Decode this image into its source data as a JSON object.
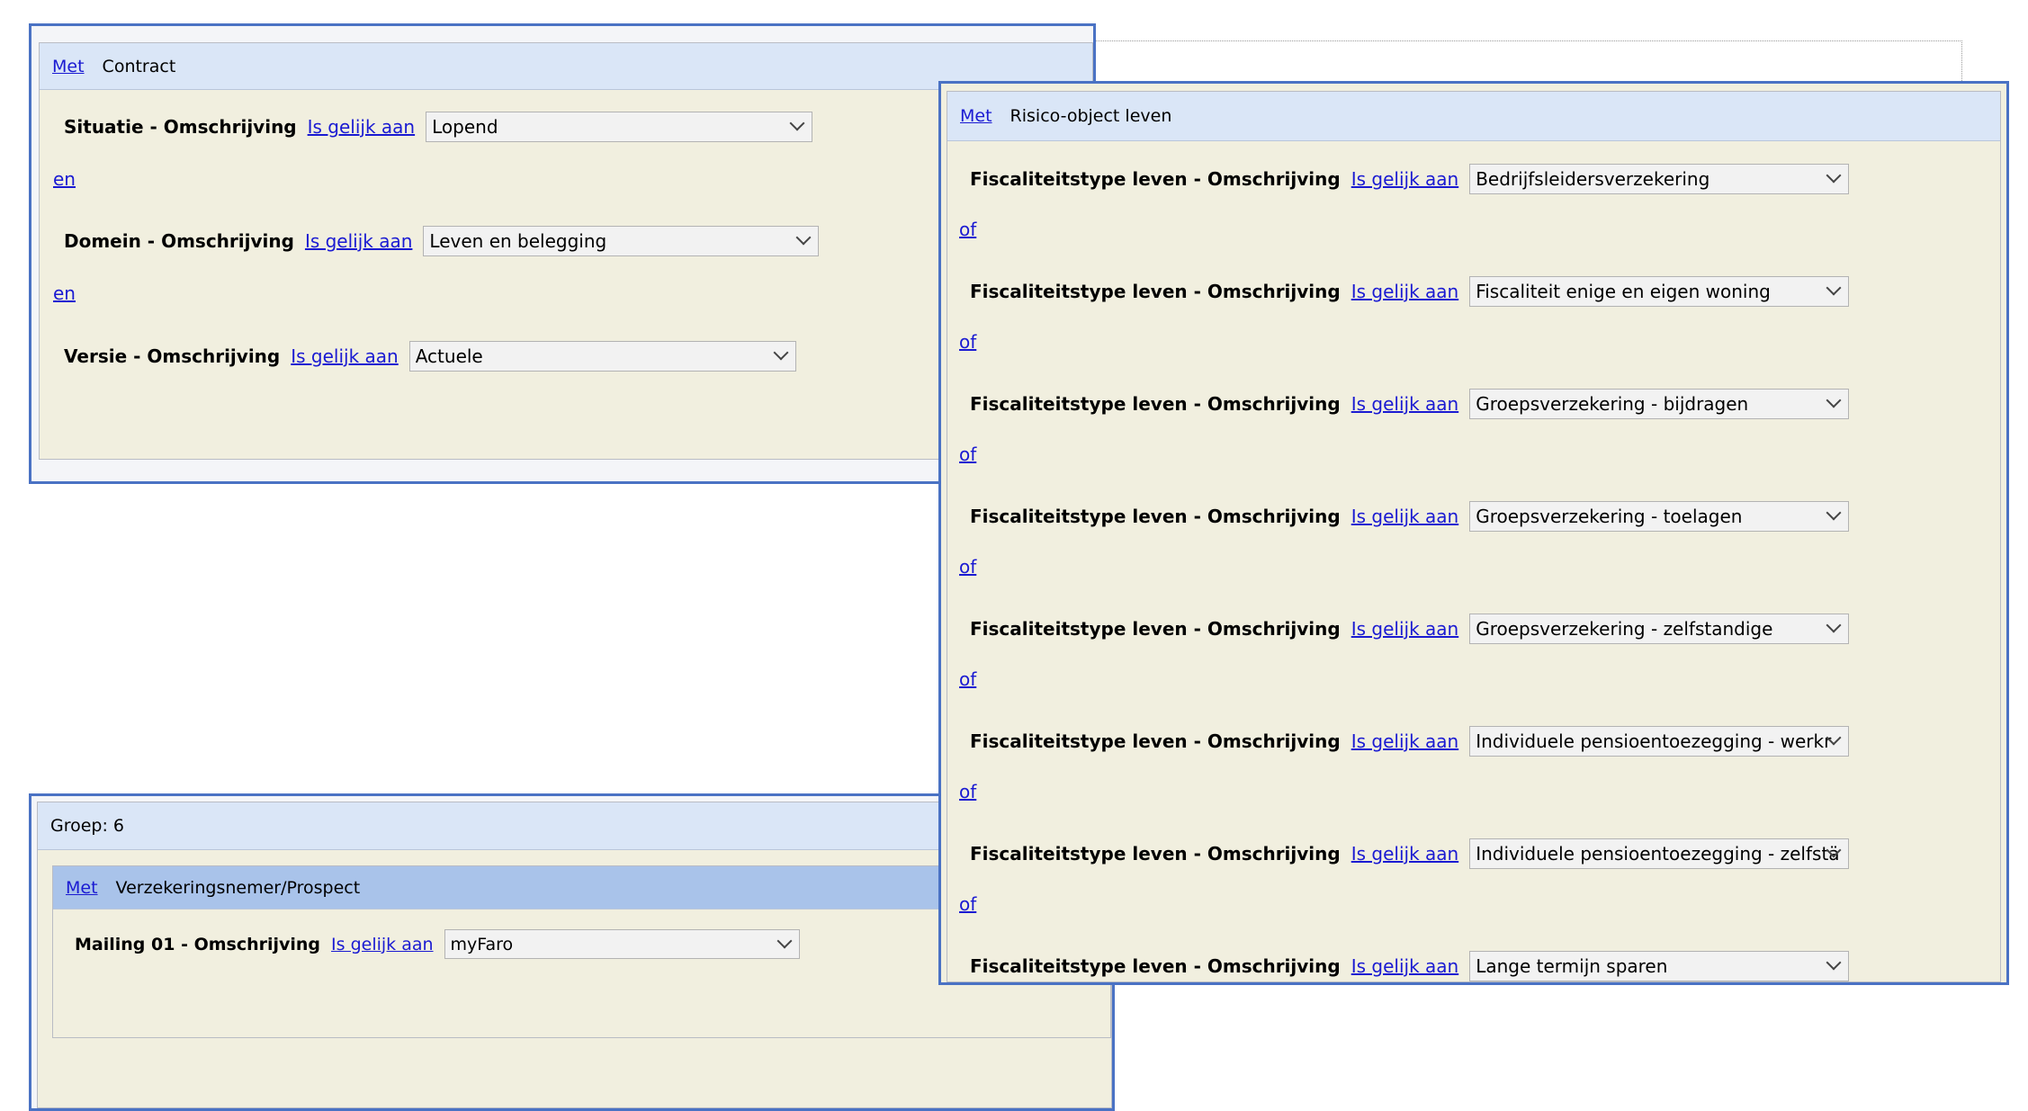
{
  "contract": {
    "met": "Met",
    "title": "Contract",
    "rows": [
      {
        "label": "Situatie - Omschrijving",
        "op": "Is gelijk aan",
        "value": "Lopend"
      },
      {
        "label": "Domein - Omschrijving",
        "op": "Is gelijk aan",
        "value": "Leven en belegging"
      },
      {
        "label": "Versie - Omschrijving",
        "op": "Is gelijk aan",
        "value": "Actuele"
      }
    ],
    "conj": [
      "en",
      "en"
    ]
  },
  "groep": {
    "title": "Groep: 6",
    "met": "Met",
    "sub_title": "Verzekeringsnemer/Prospect",
    "row": {
      "label": "Mailing 01 - Omschrijving",
      "op": "Is gelijk aan",
      "value": "myFaro"
    }
  },
  "risico": {
    "met": "Met",
    "title": "Risico-object leven",
    "rows": [
      {
        "label": "Fiscaliteitstype leven  - Omschrijving",
        "op": "Is gelijk aan",
        "value": "Bedrijfsleidersverzekering"
      },
      {
        "label": "Fiscaliteitstype leven  - Omschrijving",
        "op": "Is gelijk aan",
        "value": "Fiscaliteit enige en eigen woning"
      },
      {
        "label": "Fiscaliteitstype leven  - Omschrijving",
        "op": "Is gelijk aan",
        "value": "Groepsverzekering - bijdragen"
      },
      {
        "label": "Fiscaliteitstype leven  - Omschrijving",
        "op": "Is gelijk aan",
        "value": "Groepsverzekering - toelagen"
      },
      {
        "label": "Fiscaliteitstype leven  - Omschrijving",
        "op": "Is gelijk aan",
        "value": "Groepsverzekering - zelfstandige"
      },
      {
        "label": "Fiscaliteitstype leven  - Omschrijving",
        "op": "Is gelijk aan",
        "value": "Individuele pensioentoezegging - werkr"
      },
      {
        "label": "Fiscaliteitstype leven  - Omschrijving",
        "op": "Is gelijk aan",
        "value": "Individuele pensioentoezegging - zelfstä"
      },
      {
        "label": "Fiscaliteitstype leven  - Omschrijving",
        "op": "Is gelijk aan",
        "value": "Lange termijn sparen"
      }
    ],
    "conj": [
      "of",
      "of",
      "of",
      "of",
      "of",
      "of",
      "of"
    ]
  }
}
